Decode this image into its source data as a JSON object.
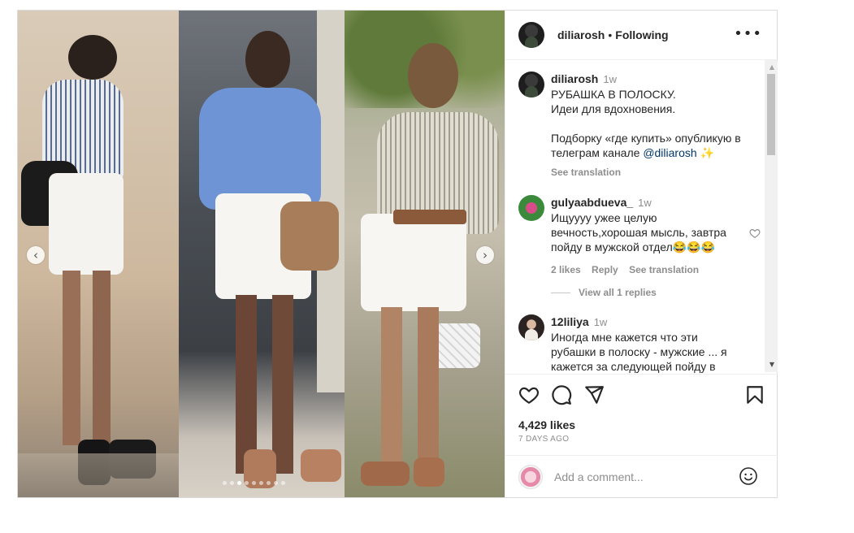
{
  "post": {
    "username": "diliarosh",
    "separator": "•",
    "follow_state": "Following",
    "more_icon": "more-horizontal-icon"
  },
  "carousel": {
    "prev_icon": "chevron-left-icon",
    "next_icon": "chevron-right-icon",
    "prev_glyph": "‹",
    "next_glyph": "›",
    "slide_count": 9,
    "active_slide": 3
  },
  "caption": {
    "username": "diliarosh",
    "time": "1w",
    "line1": "РУБАШКА В ПОЛОСКУ.",
    "line2": "Идеи для вдохновения.",
    "line3": "Подборку «где купить» опубликую в",
    "line4_prefix": "телеграм канале ",
    "mention": "@diliarosh",
    "emoji": "✨",
    "see_translation": "See translation"
  },
  "comments": [
    {
      "username": "gulyaabdueva_",
      "time": "1w",
      "line1": "Ищуууу ужее целую",
      "line2": "вечность,хорошая мысль, завтра",
      "line3": "пойду в мужской отдел😂😂😂",
      "likes": "2 likes",
      "reply": "Reply",
      "see_translation": "See translation",
      "view_replies": "View all 1 replies"
    },
    {
      "username": "12liliya",
      "time": "1w",
      "line1": "Иногда мне кажется что эти",
      "line2": "рубашки в полоску - мужские ... я",
      "line3": "кажется за следующей пойду в"
    }
  ],
  "actions": {
    "like_icon": "heart-icon",
    "comment_icon": "comment-icon",
    "share_icon": "send-icon",
    "save_icon": "bookmark-icon",
    "likes": "4,429 likes",
    "date": "7 DAYS AGO"
  },
  "add_comment": {
    "placeholder": "Add a comment...",
    "emoji_icon": "smiley-icon"
  },
  "scrollbar": {
    "up_glyph": "▲",
    "down_glyph": "▼"
  },
  "colors": {
    "border": "#dbdbdb",
    "text": "#262626",
    "muted": "#8e8e8e",
    "link": "#00376b"
  }
}
